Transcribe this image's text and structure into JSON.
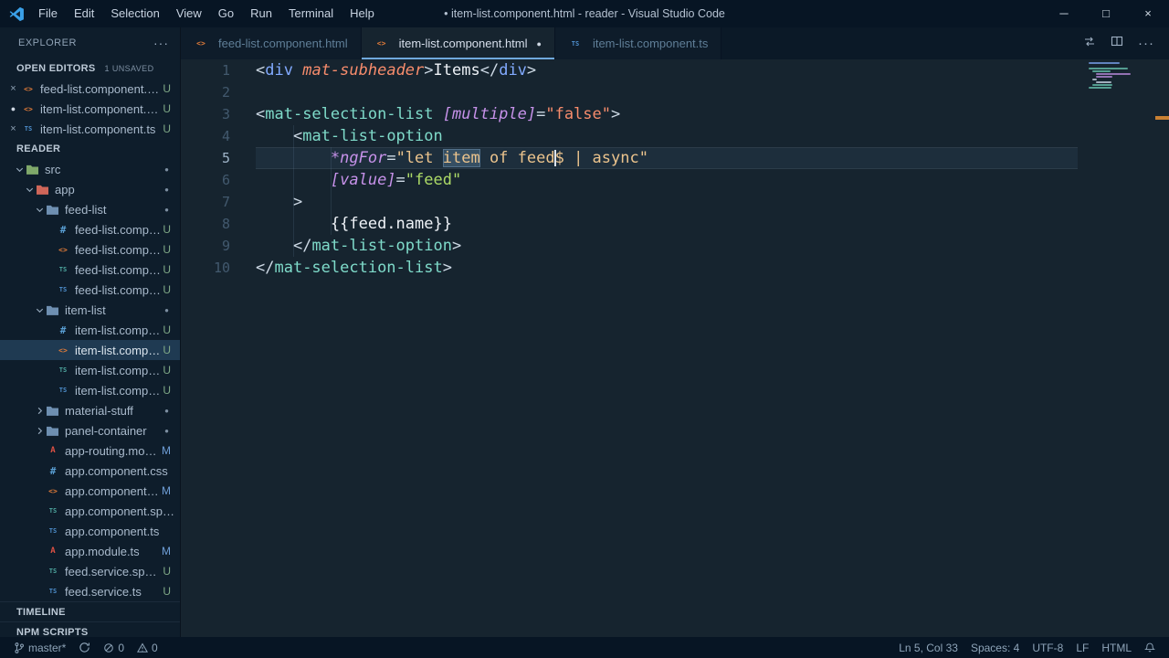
{
  "titlebar": {
    "title": "• item-list.component.html - reader - Visual Studio Code",
    "menus": [
      "File",
      "Edit",
      "Selection",
      "View",
      "Go",
      "Run",
      "Terminal",
      "Help"
    ],
    "window_controls": [
      {
        "name": "minimize",
        "glyph": "─"
      },
      {
        "name": "maximize",
        "glyph": "□"
      },
      {
        "name": "close",
        "glyph": "×"
      }
    ]
  },
  "sidebar": {
    "explorer_title": "EXPLORER",
    "open_editors": {
      "label": "OPEN EDITORS",
      "badge": "1 UNSAVED",
      "items": [
        {
          "label": "feed-list.component.html",
          "icon": "html",
          "badge": "U",
          "dirty": false
        },
        {
          "label": "item-list.component.html",
          "icon": "html",
          "badge": "U",
          "dirty": true
        },
        {
          "label": "item-list.component.ts",
          "icon": "ts",
          "badge": "U",
          "dirty": false
        }
      ]
    },
    "workspace_label": "READER",
    "tree": [
      {
        "label": "src",
        "kind": "folder",
        "depth": 1,
        "folder": "src",
        "expanded": true,
        "dot": true
      },
      {
        "label": "app",
        "kind": "folder",
        "depth": 2,
        "folder": "app",
        "expanded": true,
        "dot": true
      },
      {
        "label": "feed-list",
        "kind": "folder",
        "depth": 3,
        "folder": "default",
        "expanded": true,
        "dot": true
      },
      {
        "label": "feed-list.component.css",
        "kind": "file",
        "depth": 4,
        "icon": "css",
        "badge": "U"
      },
      {
        "label": "feed-list.component.html",
        "kind": "file",
        "depth": 4,
        "icon": "html",
        "badge": "U"
      },
      {
        "label": "feed-list.component.spec.ts",
        "kind": "file",
        "depth": 4,
        "icon": "spec",
        "badge": "U"
      },
      {
        "label": "feed-list.component.ts",
        "kind": "file",
        "depth": 4,
        "icon": "ts",
        "badge": "U"
      },
      {
        "label": "item-list",
        "kind": "folder",
        "depth": 3,
        "folder": "default",
        "expanded": true,
        "dot": true
      },
      {
        "label": "item-list.component.css",
        "kind": "file",
        "depth": 4,
        "icon": "css",
        "badge": "U"
      },
      {
        "label": "item-list.component.html",
        "kind": "file",
        "depth": 4,
        "icon": "html",
        "badge": "U",
        "selected": true
      },
      {
        "label": "item-list.component.spec.ts",
        "kind": "file",
        "depth": 4,
        "icon": "spec",
        "badge": "U"
      },
      {
        "label": "item-list.component.ts",
        "kind": "file",
        "depth": 4,
        "icon": "ts",
        "badge": "U"
      },
      {
        "label": "material-stuff",
        "kind": "folder",
        "depth": 3,
        "folder": "default",
        "expanded": false,
        "dot": true
      },
      {
        "label": "panel-container",
        "kind": "folder",
        "depth": 3,
        "folder": "default",
        "expanded": false,
        "dot": true
      },
      {
        "label": "app-routing.module.ts",
        "kind": "file",
        "depth": 3,
        "icon": "ng",
        "badge": "M"
      },
      {
        "label": "app.component.css",
        "kind": "file",
        "depth": 3,
        "icon": "css"
      },
      {
        "label": "app.component.html",
        "kind": "file",
        "depth": 3,
        "icon": "html",
        "badge": "M"
      },
      {
        "label": "app.component.spec.ts",
        "kind": "file",
        "depth": 3,
        "icon": "spec"
      },
      {
        "label": "app.component.ts",
        "kind": "file",
        "depth": 3,
        "icon": "ts"
      },
      {
        "label": "app.module.ts",
        "kind": "file",
        "depth": 3,
        "icon": "ng",
        "badge": "M"
      },
      {
        "label": "feed.service.spec.ts",
        "kind": "file",
        "depth": 3,
        "icon": "spec",
        "badge": "U"
      },
      {
        "label": "feed.service.ts",
        "kind": "file",
        "depth": 3,
        "icon": "ts",
        "badge": "U"
      }
    ],
    "timeline_label": "TIMELINE",
    "npm_label": "NPM SCRIPTS"
  },
  "editor": {
    "tabs": [
      {
        "label": "feed-list.component.html",
        "icon": "html",
        "active": false,
        "dirty": false
      },
      {
        "label": "item-list.component.html",
        "icon": "html",
        "active": true,
        "dirty": true
      },
      {
        "label": "item-list.component.ts",
        "icon": "ts",
        "active": false,
        "dirty": false
      }
    ],
    "current_line": 5,
    "lines": [
      {
        "num": 1,
        "segs": [
          [
            "<",
            "p"
          ],
          [
            "div",
            "tb"
          ],
          [
            " ",
            "pl"
          ],
          [
            "mat-subheader",
            "ar"
          ],
          [
            ">",
            "p"
          ],
          [
            "Items",
            "tx"
          ],
          [
            "</",
            "p"
          ],
          [
            "div",
            "tb"
          ],
          [
            ">",
            "p"
          ]
        ]
      },
      {
        "num": 2,
        "segs": []
      },
      {
        "num": 3,
        "segs": [
          [
            "<",
            "p"
          ],
          [
            "mat-selection-list",
            "tt"
          ],
          [
            " ",
            "pl"
          ],
          [
            "[multiple]",
            "ap"
          ],
          [
            "=",
            "p"
          ],
          [
            "\"false\"",
            "sr"
          ],
          [
            ">",
            "p"
          ]
        ]
      },
      {
        "num": 4,
        "segs": [
          [
            "    ",
            "pl"
          ],
          [
            "<",
            "p"
          ],
          [
            "mat-list-option",
            "tt"
          ]
        ]
      },
      {
        "num": 5,
        "segs": [
          [
            "        ",
            "pl"
          ],
          [
            "*ngFor",
            "ap"
          ],
          [
            "=",
            "p"
          ],
          [
            "\"let ",
            "s"
          ],
          [
            "item",
            "shl"
          ],
          [
            " of feed",
            "s"
          ],
          [
            "",
            "cur"
          ],
          [
            "$ | async\"",
            "s"
          ]
        ]
      },
      {
        "num": 6,
        "segs": [
          [
            "        ",
            "pl"
          ],
          [
            "[value]",
            "ap"
          ],
          [
            "=",
            "p"
          ],
          [
            "\"feed\"",
            "sg"
          ]
        ]
      },
      {
        "num": 7,
        "segs": [
          [
            "    ",
            "pl"
          ],
          [
            ">",
            "p"
          ]
        ]
      },
      {
        "num": 8,
        "segs": [
          [
            "        ",
            "pl"
          ],
          [
            "{{feed.name}}",
            "tx"
          ]
        ]
      },
      {
        "num": 9,
        "segs": [
          [
            "    ",
            "pl"
          ],
          [
            "</",
            "p"
          ],
          [
            "mat-list-option",
            "tt"
          ],
          [
            ">",
            "p"
          ]
        ]
      },
      {
        "num": 10,
        "segs": [
          [
            "</",
            "p"
          ],
          [
            "mat-selection-list",
            "tt"
          ],
          [
            ">",
            "p"
          ]
        ]
      }
    ]
  },
  "status_bar": {
    "left": [
      {
        "name": "git-branch",
        "icon": "branch",
        "label": "master*"
      },
      {
        "name": "sync-button",
        "icon": "sync",
        "label": ""
      },
      {
        "name": "error-count",
        "icon": "error",
        "label": "0"
      },
      {
        "name": "warning-count",
        "icon": "warning",
        "label": "0"
      }
    ],
    "right": [
      {
        "name": "cursor-position",
        "label": "Ln 5, Col 33"
      },
      {
        "name": "indentation",
        "label": "Spaces: 4"
      },
      {
        "name": "encoding",
        "label": "UTF-8"
      },
      {
        "name": "eol-sequence",
        "label": "LF"
      },
      {
        "name": "language-mode",
        "label": "HTML"
      },
      {
        "name": "notifications-bell",
        "icon": "bell",
        "label": ""
      }
    ]
  },
  "colors": {
    "tag_blue": "#82aaff",
    "tag_teal": "#7fdbca",
    "attr_italic_orange": "#f78c6c",
    "attr_italic_purple": "#c792ea",
    "string_tan": "#ecc48d",
    "string_green": "#addb67",
    "active_tab_underline": "#6fa8dc",
    "overview_marker": "#c98133",
    "html_icon": "#e07b39",
    "css_icon": "#5a9fd4",
    "ts_icon": "#4e8fce",
    "angular_icon": "#dd5144",
    "editor_bg": "#16242f",
    "sidebar_bg": "#0e1d2b",
    "titlebar_bg": "#071524"
  }
}
